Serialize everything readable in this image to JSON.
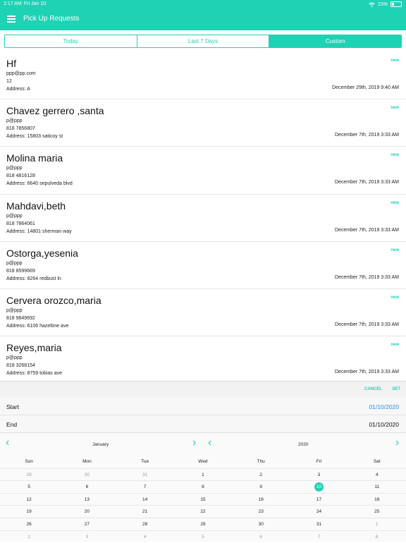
{
  "status_bar": {
    "time": "2:17 AM",
    "date": "Fri Jan 10",
    "battery": "23%",
    "battery_level": 0.23
  },
  "header": {
    "title": "Pick Up Requests"
  },
  "tabs": [
    {
      "label": "Today",
      "active": false
    },
    {
      "label": "Last 7 Days",
      "active": false
    },
    {
      "label": "Custom",
      "active": true
    }
  ],
  "requests": [
    {
      "name": "Hf",
      "email": "ppp@pp.com",
      "phone": "12",
      "address": "Address: A",
      "status": "new",
      "timestamp": "December 29th, 2019 9:40 AM"
    },
    {
      "name": "Chavez gerrero ,santa",
      "email": "p@ppp",
      "phone": "818 7856807",
      "address": "Address: 15803 saticoy st",
      "status": "new",
      "timestamp": "December 7th, 2019 3:33 AM"
    },
    {
      "name": "Molina maria",
      "email": "p@ppp",
      "phone": "818 4816128",
      "address": "Address: 6640 sepulveda blvd",
      "status": "new",
      "timestamp": "December 7th, 2019 3:33 AM"
    },
    {
      "name": "Mahdavi,beth",
      "email": "p@ppp",
      "phone": "818 7864061",
      "address": "Address: 14801 sherman way",
      "status": "new",
      "timestamp": "December 7th, 2019 3:33 AM"
    },
    {
      "name": "Ostorga,yesenia",
      "email": "p@ppp",
      "phone": "818 8599669",
      "address": "Address: 8264 redbust ln",
      "status": "new",
      "timestamp": "December 7th, 2019 3:33 AM"
    },
    {
      "name": "Cervera orozco,maria",
      "email": "p@ppp",
      "phone": "818 9849692",
      "address": "Address: 6106 hazeltine ave",
      "status": "new",
      "timestamp": "December 7th, 2019 3:33 AM"
    },
    {
      "name": "Reyes,maria",
      "email": "p@ppp",
      "phone": "818 3268154",
      "address": "Address: 8759 tobias ave",
      "status": "new",
      "timestamp": "December 7th, 2019 3:33 AM"
    }
  ],
  "picker": {
    "cancel_label": "CANCEL",
    "set_label": "SET",
    "start_label": "Start",
    "start_value": "01/10/2020",
    "end_label": "End",
    "end_value": "01/10/2020",
    "month_label": "January",
    "year_label": "2020",
    "weekdays": [
      "Sun",
      "Mon",
      "Tue",
      "Wed",
      "Thu",
      "Fri",
      "Sat"
    ],
    "weeks": [
      [
        "29",
        "30",
        "31",
        "1",
        "2",
        "3",
        "4"
      ],
      [
        "5",
        "6",
        "7",
        "8",
        "9",
        "10",
        "11"
      ],
      [
        "12",
        "13",
        "14",
        "15",
        "16",
        "17",
        "18"
      ],
      [
        "19",
        "20",
        "21",
        "22",
        "23",
        "24",
        "25"
      ],
      [
        "26",
        "27",
        "28",
        "29",
        "30",
        "31",
        "1"
      ],
      [
        "2",
        "3",
        "4",
        "5",
        "6",
        "7",
        "8"
      ]
    ],
    "selected_day": "10"
  },
  "colors": {
    "accent": "#1ed2b4",
    "link_blue": "#2b8ed6"
  }
}
